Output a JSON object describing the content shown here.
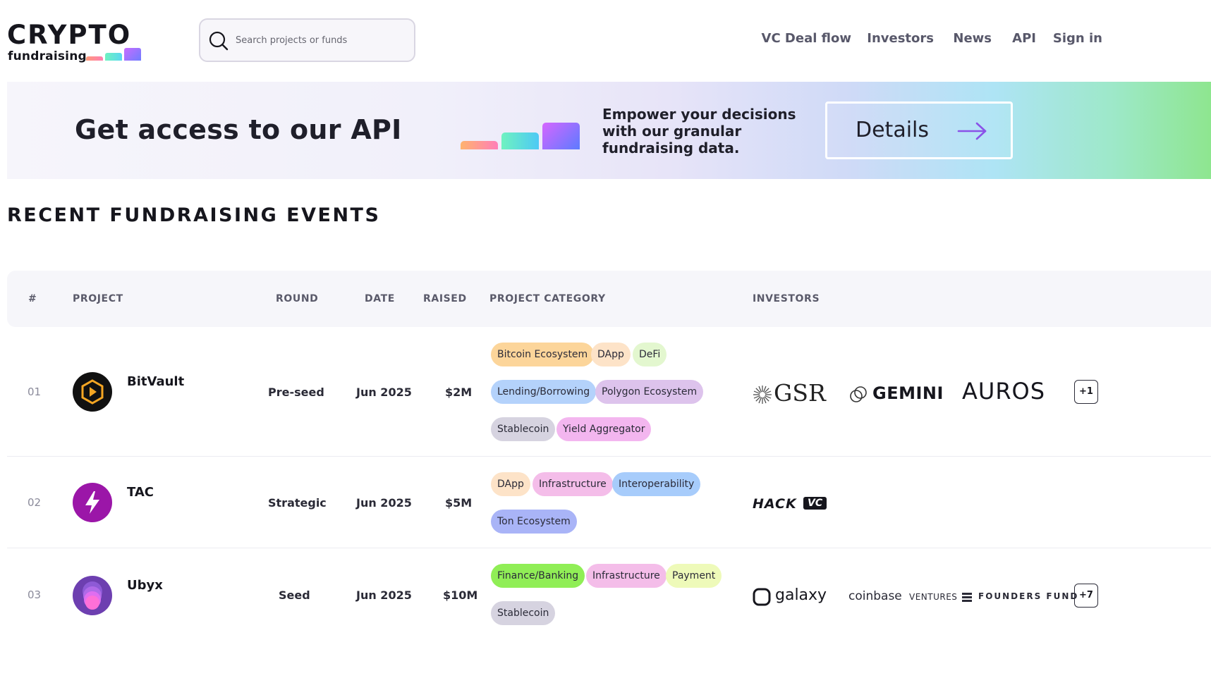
{
  "logo": {
    "word": "CRYPTO",
    "sub": "fundraising"
  },
  "search": {
    "placeholder": "Search projects or funds"
  },
  "nav": {
    "items": [
      {
        "label": "VC Deal flow"
      },
      {
        "label": "Investors"
      },
      {
        "label": "News"
      },
      {
        "label": "API"
      },
      {
        "label": "Sign in"
      }
    ]
  },
  "banner": {
    "title": "Get access to our API",
    "text": "Empower your decisions with our granular fundraising data.",
    "button_label": "Details"
  },
  "section": {
    "title": "RECENT FUNDRAISING EVENTS"
  },
  "table": {
    "headers": {
      "num": "#",
      "project": "PROJECT",
      "round": "ROUND",
      "date": "DATE",
      "raised": "RAISED",
      "category": "PROJECT CATEGORY",
      "investors": "INVESTORS"
    },
    "rows": [
      {
        "num": "01",
        "project": "BitVault",
        "round": "Pre-seed",
        "date": "Jun 2025",
        "raised": "$2M",
        "categories": [
          "Bitcoin Ecosystem",
          "DApp",
          "DeFi",
          "Lending/Borrowing",
          "Polygon Ecosystem",
          "Stablecoin",
          "Yield Aggregator"
        ],
        "investors": [
          "GSR",
          "GEMINI",
          "AUROS"
        ],
        "more": "+1"
      },
      {
        "num": "02",
        "project": "TAC",
        "round": "Strategic",
        "date": "Jun 2025",
        "raised": "$5M",
        "categories": [
          "DApp",
          "Infrastructure",
          "Interoperability",
          "Ton Ecosystem"
        ],
        "investors": [
          "HACK",
          "VC"
        ],
        "more": ""
      },
      {
        "num": "03",
        "project": "Ubyx",
        "round": "Seed",
        "date": "Jun 2025",
        "raised": "$10M",
        "categories": [
          "Finance/Banking",
          "Infrastructure",
          "Payment",
          "Stablecoin"
        ],
        "investors": [
          "galaxy",
          "coinbase",
          "VENTURES",
          "FOUNDERS FUND"
        ],
        "more": "+7"
      }
    ]
  },
  "colors": {
    "tag_bitcoin": "#fcd59a",
    "tag_dapp": "#fde3c8",
    "tag_defi": "#e3f7cf",
    "tag_lending": "#b4d2fb",
    "tag_polygon": "#ddc3ec",
    "tag_stablecoin": "#d6d3e0",
    "tag_yield": "#f3b6ef",
    "tag_infra": "#f4bde9",
    "tag_interop": "#a7ccfb",
    "tag_ton": "#a9b4f7",
    "tag_finance": "#90ee56",
    "tag_payment": "#eefab9"
  }
}
